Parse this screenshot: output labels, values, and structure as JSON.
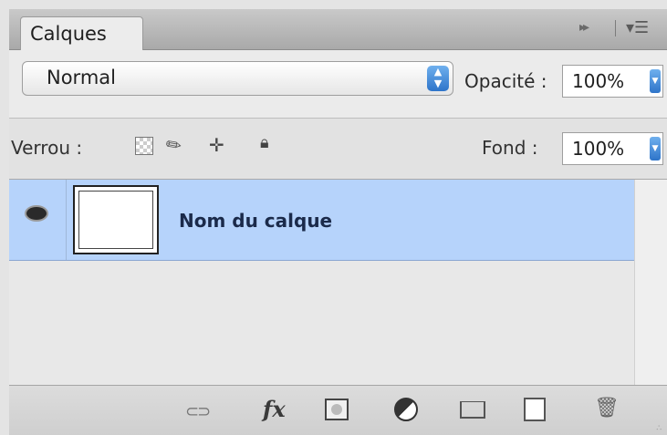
{
  "panel": {
    "tab_label": "Calques",
    "collapse_icon": "double-arrow-icon",
    "menu_icon": "panel-menu-icon"
  },
  "blend": {
    "mode": "Normal",
    "opacity_label": "Opacité :",
    "opacity_value": "100%"
  },
  "lock": {
    "label": "Verrou :",
    "icons": [
      "lock-transparency-icon",
      "lock-pixels-icon",
      "lock-position-icon",
      "lock-all-icon"
    ],
    "fill_label": "Fond :",
    "fill_value": "100%"
  },
  "layers": [
    {
      "name": "Nom du calque",
      "visible": true,
      "selected": true
    }
  ],
  "bottom_toolbar": {
    "icons": [
      "link-layers-icon",
      "fx-icon",
      "layer-mask-icon",
      "adjustment-layer-icon",
      "group-folder-icon",
      "new-layer-icon",
      "trash-icon"
    ],
    "fx_text": "fx"
  },
  "colors": {
    "selected_row": "#b6d3fb",
    "accent": "#2e74c9"
  }
}
